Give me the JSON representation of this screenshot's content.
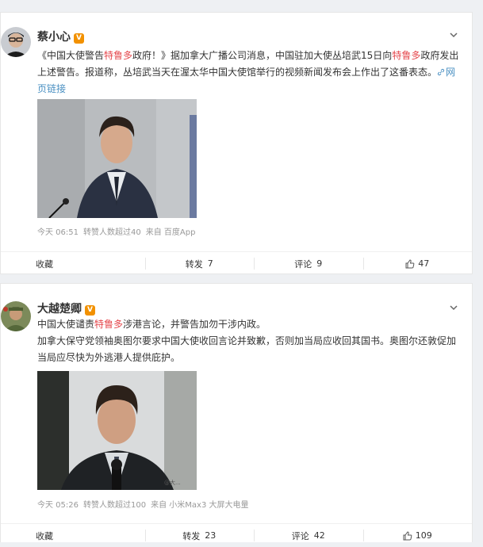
{
  "posts": [
    {
      "user": "蔡小心",
      "verified_badge": "V",
      "text_parts": {
        "p1": "《中国大使警告",
        "kw1": "特鲁多",
        "p2": "政府！》据加拿大广播公司消息，中国驻加大使丛培武15日向",
        "kw2": "特鲁多",
        "p3": "政府发出上述警告。报道称，丛培武当天在渥太华中国大使馆举行的视频新闻发布会上作出了这番表态。",
        "link": "网页链接"
      },
      "meta": {
        "time": "今天 06:51",
        "reposts_info": "转赞人数超过40",
        "source": "来自 百度App"
      },
      "actions": {
        "collect": "收藏",
        "repost": "转发",
        "repost_count": "7",
        "comment": "评论",
        "comment_count": "9",
        "like_count": "47"
      }
    },
    {
      "user": "大越楚卿",
      "verified_badge": "V",
      "text_parts": {
        "l1a": "中国大使谴责",
        "kw1": "特鲁多",
        "l1b": "涉港言论，并警告加勿干涉内政。",
        "l2": "加拿大保守党领袖奥图尔要求中国大使收回言论并致歉，否则加当局应收回其国书。奥图尔还敦促加当局应尽快为外逃港人提供庇护。"
      },
      "image_watermark": "@大...",
      "meta": {
        "time": "今天 05:26",
        "reposts_info": "转赞人数超过100",
        "source": "来自 小米Max3 大屏大电量"
      },
      "actions": {
        "collect": "收藏",
        "repost": "转发",
        "repost_count": "23",
        "comment": "评论",
        "comment_count": "42",
        "like_count": "109"
      }
    }
  ],
  "colors": {
    "keyword": "#e5484d",
    "link": "#4a90c2",
    "badge": "#f29100",
    "meta": "#999999"
  }
}
